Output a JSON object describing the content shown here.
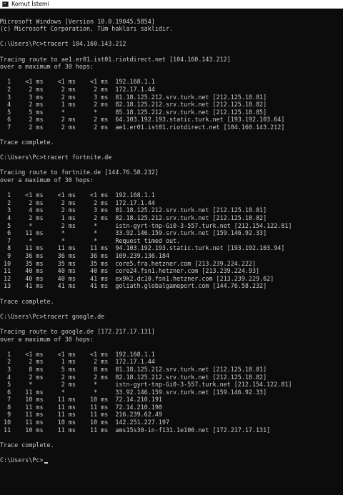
{
  "window": {
    "title": "Komut İstemi",
    "icon": "console-icon"
  },
  "console": {
    "lines": [
      "Microsoft Windows [Version 10.0.19045.5854]",
      "(c) Microsoft Corporation. Tüm hakları saklıdır.",
      "",
      "C:\\Users\\Pc>tracert 104.160.143.212",
      "",
      "Tracing route to ae1.er01.ist01.riotdirect.net [104.160.143.212]",
      "over a maximum of 30 hops:",
      "",
      "  1    <1 ms    <1 ms    <1 ms  192.168.1.1",
      "  2     2 ms     2 ms     2 ms  172.17.1.44",
      "  3     3 ms     2 ms     3 ms  81.18.125.212.srv.turk.net [212.125.18.81]",
      "  4     2 ms     1 ms     2 ms  82.18.125.212.srv.turk.net [212.125.18.82]",
      "  5     5 ms     *        *     85.18.125.212.srv.turk.net [212.125.18.85]",
      "  6     2 ms     2 ms     2 ms  64.103.192.193.static.turk.net [193.192.103.64]",
      "  7     2 ms     2 ms     2 ms  ae1.er01.ist01.riotdirect.net [104.160.143.212]",
      "",
      "Trace complete.",
      "",
      "C:\\Users\\Pc>tracert fortnite.de",
      "",
      "Tracing route to fortnite.de [144.76.58.232]",
      "over a maximum of 30 hops:",
      "",
      "  1    <1 ms    <1 ms    <1 ms  192.168.1.1",
      "  2     2 ms     2 ms     2 ms  172.17.1.44",
      "  3     4 ms     2 ms     3 ms  81.18.125.212.srv.turk.net [212.125.18.81]",
      "  4     2 ms     1 ms     2 ms  82.18.125.212.srv.turk.net [212.125.18.82]",
      "  5     *        2 ms     *     istn-gyrt-tnp-Gi0-3-557.turk.net [212.154.122.81]",
      "  6    11 ms     *        *     33.92.146.159.srv.turk.net [159.146.92.33]",
      "  7     *        *        *     Request timed out.",
      "  8    11 ms    11 ms    11 ms  94.103.192.193.static.turk.net [193.192.103.94]",
      "  9    36 ms    36 ms    36 ms  109.239.136.184",
      " 10    35 ms    35 ms    35 ms  core5.fra.hetzner.com [213.239.224.222]",
      " 11    40 ms    40 ms    40 ms  core24.fsn1.hetzner.com [213.239.224.93]",
      " 12    40 ms    40 ms    41 ms  ex9k2.dc10.fsn1.hetzner.com [213.239.229.62]",
      " 13    41 ms    41 ms    41 ms  goliath.globalgameport.com [144.76.58.232]",
      "",
      "Trace complete.",
      "",
      "C:\\Users\\Pc>tracert google.de",
      "",
      "Tracing route to google.de [172.217.17.131]",
      "over a maximum of 30 hops:",
      "",
      "  1    <1 ms    <1 ms    <1 ms  192.168.1.1",
      "  2     2 ms     1 ms     2 ms  172.17.1.44",
      "  3     8 ms     5 ms     8 ms  81.18.125.212.srv.turk.net [212.125.18.81]",
      "  4     2 ms     2 ms     2 ms  82.18.125.212.srv.turk.net [212.125.18.82]",
      "  5     *        2 ms     *     istn-gyrt-tnp-Gi0-3-557.turk.net [212.154.122.81]",
      "  6    11 ms     *        *     33.92.146.159.srv.turk.net [159.146.92.33]",
      "  7    10 ms    11 ms    10 ms  72.14.210.191",
      "  8    11 ms    11 ms    11 ms  72.14.210.190",
      "  9    11 ms    11 ms    11 ms  216.239.62.49",
      " 10    11 ms    10 ms    10 ms  142.251.227.197",
      " 11    10 ms    11 ms    11 ms  ams15s30-in-f131.1e100.net [172.217.17.131]",
      "",
      "Trace complete.",
      ""
    ],
    "prompt": "C:\\Users\\Pc>"
  }
}
